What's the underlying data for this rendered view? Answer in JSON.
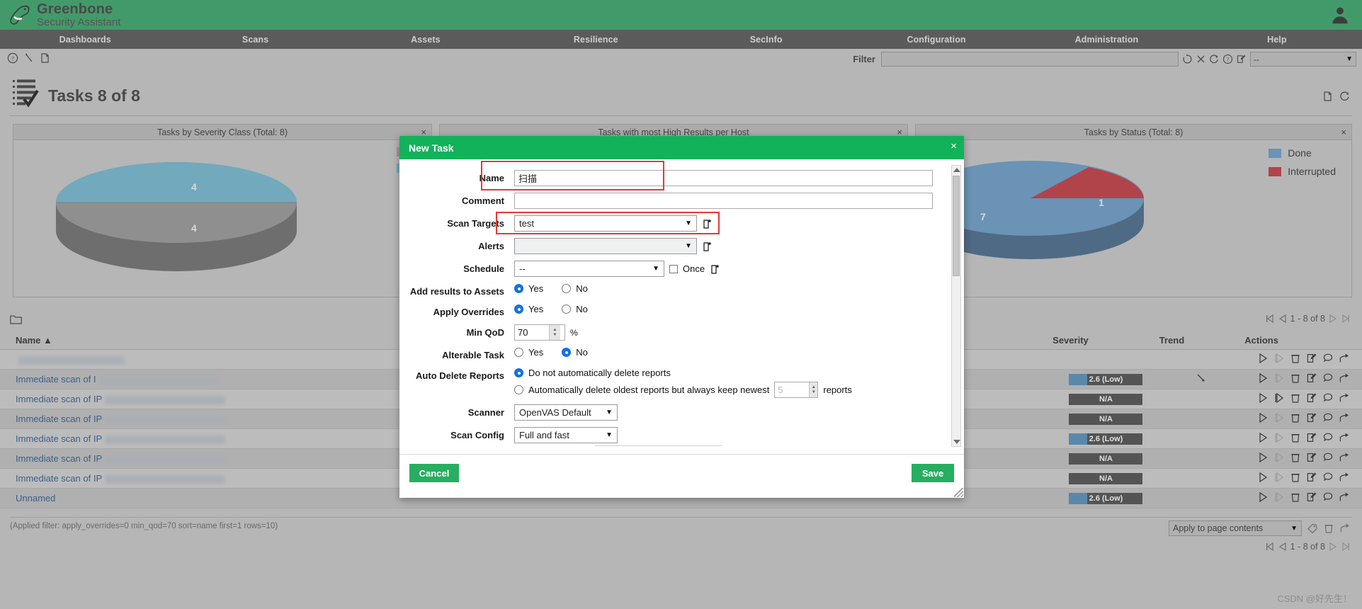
{
  "brand": {
    "line1": "Greenbone",
    "line2": "Security Assistant",
    "accent": "#429a6a",
    "user_icon": "user-icon"
  },
  "menu": {
    "items": [
      {
        "label": "Dashboards",
        "name": "menu-dashboards"
      },
      {
        "label": "Scans",
        "name": "menu-scans"
      },
      {
        "label": "Assets",
        "name": "menu-assets"
      },
      {
        "label": "Resilience",
        "name": "menu-resilience"
      },
      {
        "label": "SecInfo",
        "name": "menu-secinfo"
      },
      {
        "label": "Configuration",
        "name": "menu-configuration"
      },
      {
        "label": "Administration",
        "name": "menu-administration"
      },
      {
        "label": "Help",
        "name": "menu-help"
      }
    ]
  },
  "toolbar": {
    "icons": [
      "help-circle-icon",
      "wizard-wand-icon",
      "new-task-icon"
    ],
    "filter_label": "Filter",
    "filter_value": "",
    "filter_placeholder": "",
    "filter_icons": [
      "update-filter-icon",
      "reset-filter-icon",
      "refresh-icon",
      "help-circle-icon",
      "edit-filter-icon"
    ],
    "filter_select_value": "--"
  },
  "page": {
    "title": "Tasks 8 of 8",
    "title_icon": "task-list-icon",
    "right_icons": [
      "export-icon",
      "refresh-icon"
    ]
  },
  "dashboards": [
    {
      "name": "panel-severity",
      "title": "Tasks by Severity Class (Total: 8)",
      "close": "×",
      "legend": [
        {
          "label": "",
          "color": "#9e9e9e"
        },
        {
          "label": "",
          "color": "#72a9bd"
        }
      ]
    },
    {
      "name": "panel-high-results",
      "title": "Tasks with most High Results per Host",
      "close": "×",
      "legend": []
    },
    {
      "name": "panel-status",
      "title": "Tasks by Status (Total: 8)",
      "close": "×",
      "legend": [
        {
          "label": "Done",
          "color": "#6a93b5"
        },
        {
          "label": "Interrupted",
          "color": "#b1444a"
        }
      ]
    }
  ],
  "chart_data": [
    {
      "type": "pie",
      "title": "Tasks by Severity Class (Total: 8)",
      "labels": [
        "",
        ""
      ],
      "values": [
        4,
        4
      ],
      "colors": [
        "#72a9bd",
        "#9e9e9e"
      ],
      "total": 8,
      "legend_position": "right"
    },
    {
      "type": "pie",
      "title": "Tasks by Status (Total: 8)",
      "labels": [
        "Done",
        "Interrupted"
      ],
      "values": [
        7,
        1
      ],
      "colors": [
        "#6a93b5",
        "#b1444a"
      ],
      "total": 8,
      "legend_position": "right"
    }
  ],
  "table": {
    "folder_icon": "folder-icon",
    "pager_top": "1 - 8 of 8",
    "pager_bottom": "1 - 8 of 8",
    "columns": [
      {
        "label": "Name ▲",
        "name": "column-name"
      },
      {
        "label": "Severity",
        "name": "column-severity"
      },
      {
        "label": "Trend",
        "name": "column-trend"
      },
      {
        "label": "Actions",
        "name": "column-actions"
      }
    ],
    "rows": [
      {
        "name": "",
        "redacted": true,
        "severity": "",
        "sev_kind": "none",
        "trend": ""
      },
      {
        "name": "Immediate scan of I",
        "redacted": true,
        "severity": "2.6 (Low)",
        "sev_kind": "low",
        "trend": "down"
      },
      {
        "name": "Immediate scan of IP",
        "redacted": true,
        "severity": "N/A",
        "sev_kind": "na",
        "trend": ""
      },
      {
        "name": "Immediate scan of IP",
        "redacted": true,
        "severity": "N/A",
        "sev_kind": "na",
        "trend": ""
      },
      {
        "name": "Immediate scan of IP",
        "redacted": true,
        "severity": "2.6 (Low)",
        "sev_kind": "low",
        "trend": ""
      },
      {
        "name": "Immediate scan of IP",
        "redacted": true,
        "severity": "N/A",
        "sev_kind": "na",
        "trend": ""
      },
      {
        "name": "Immediate scan of IP",
        "redacted": true,
        "severity": "N/A",
        "sev_kind": "na",
        "trend": ""
      },
      {
        "name": "Unnamed",
        "redacted": false,
        "severity": "2.6 (Low)",
        "sev_kind": "low",
        "trend": ""
      }
    ],
    "action_icons": [
      "start-icon",
      "resume-icon",
      "delete-icon",
      "edit-icon",
      "clone-icon",
      "export-icon"
    ],
    "apply_select": "Apply to page contents",
    "bulk_icons": [
      "tag-icon",
      "trash-icon",
      "export-icon"
    ],
    "applied_filter": "(Applied filter: apply_overrides=0 min_qod=70 sort=name first=1 rows=10)"
  },
  "dialog": {
    "title": "New Task",
    "close": "×",
    "fields": {
      "name_label": "Name",
      "name_value": "扫描",
      "comment_label": "Comment",
      "comment_value": "",
      "scan_targets_label": "Scan Targets",
      "scan_targets_value": "test",
      "alerts_label": "Alerts",
      "alerts_value": "",
      "schedule_label": "Schedule",
      "schedule_value": "--",
      "schedule_once_label": "Once",
      "add_results_label": "Add results to Assets",
      "add_results_value": "Yes",
      "apply_overrides_label": "Apply Overrides",
      "apply_overrides_value": "Yes",
      "min_qod_label": "Min QoD",
      "min_qod_value": "70",
      "min_qod_unit": "%",
      "alterable_label": "Alterable Task",
      "alterable_value": "No",
      "auto_delete_label": "Auto Delete Reports",
      "auto_delete_opt1": "Do not automatically delete reports",
      "auto_delete_opt2": "Automatically delete oldest reports but always keep newest",
      "auto_delete_keep": "5",
      "auto_delete_suffix": "reports",
      "scanner_label": "Scanner",
      "scanner_value": "OpenVAS Default",
      "scan_config_label": "Scan Config",
      "scan_config_value": "Full and fast",
      "yes_label": "Yes",
      "no_label": "No"
    },
    "buttons": {
      "cancel": "Cancel",
      "save": "Save"
    },
    "accent": "#11b25a"
  },
  "annotations": {
    "color": "#e53935",
    "boxes": [
      "name-field-highlight",
      "scan-targets-highlight"
    ]
  },
  "watermark": "CSDN @好先生！"
}
